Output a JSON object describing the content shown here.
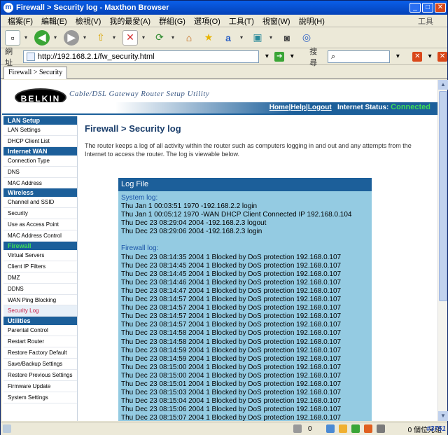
{
  "window": {
    "title": "Firewall > Security log - Maxthon Browser",
    "app_icon": "m"
  },
  "menu": {
    "items": [
      "檔案(F)",
      "編輯(E)",
      "檢視(V)",
      "我的最愛(A)",
      "群組(G)",
      "選項(O)",
      "工具(T)",
      "視窗(W)",
      "說明(H)"
    ],
    "right_label": "工具"
  },
  "address": {
    "label": "網址",
    "url": "http://192.168.2.1/fw_security.html",
    "search_label": "搜尋"
  },
  "tab": {
    "label": "Firewall > Security"
  },
  "banner": {
    "logo": "BELKIN",
    "tagline": "Cable/DSL Gateway Router Setup Utility",
    "home": "Home",
    "help": "Help",
    "logout": "Logout",
    "sep": "|",
    "internet_status_label": "Internet Status:",
    "internet_status_value": "Connected"
  },
  "sidebar": {
    "groups": [
      {
        "header": "LAN Setup",
        "items": [
          "LAN Settings",
          "DHCP Client List"
        ]
      },
      {
        "header": "Internet WAN",
        "items": [
          "Connection Type",
          "DNS",
          "MAC Address"
        ]
      },
      {
        "header": "Wireless",
        "items": [
          "Channel and SSID",
          "Security",
          "Use as Access Point",
          "MAC Address Control"
        ]
      },
      {
        "header": "Firewall",
        "items": [
          "Virtual Servers",
          "Client IP Filters",
          "DMZ",
          "DDNS",
          "WAN Ping Blocking",
          "Security Log"
        ]
      },
      {
        "header": "Utilities",
        "items": [
          "Parental Control",
          "Restart Router",
          "Restore Factory Default",
          "Save/Backup Settings",
          "Restore Previous Settings",
          "Firmware Update",
          "System Settings"
        ]
      }
    ]
  },
  "main": {
    "title": "Firewall > Security log",
    "intro": "The router keeps a log of all activity within the router such as computers logging in and out and any attempts from the Internet to access the router. The log is viewable below.",
    "logfile_title": "Log File",
    "system_log_label": "System log:",
    "system_log": [
      "Thu Jan 1 00:03:51 1970 -192.168.2.2 login",
      "Thu Jan 1 00:05:12 1970 -WAN DHCP Client Connected IP 192.168.0.104",
      "Thu Dec 23 08:29:04 2004 -192.168.2.3 logout",
      "Thu Dec 23 08:29:06 2004 -192.168.2.3 login"
    ],
    "firewall_log_label": "Firewall log:",
    "firewall_log": [
      "Thu Dec 23 08:14:35 2004 1 Blocked by DoS protection 192.168.0.107",
      "Thu Dec 23 08:14:45 2004 1 Blocked by DoS protection 192.168.0.107",
      "Thu Dec 23 08:14:45 2004 1 Blocked by DoS protection 192.168.0.107",
      "Thu Dec 23 08:14:46 2004 1 Blocked by DoS protection 192.168.0.107",
      "Thu Dec 23 08:14:47 2004 1 Blocked by DoS protection 192.168.0.107",
      "Thu Dec 23 08:14:57 2004 1 Blocked by DoS protection 192.168.0.107",
      "Thu Dec 23 08:14:57 2004 1 Blocked by DoS protection 192.168.0.107",
      "Thu Dec 23 08:14:57 2004 1 Blocked by DoS protection 192.168.0.107",
      "Thu Dec 23 08:14:57 2004 1 Blocked by DoS protection 192.168.0.107",
      "Thu Dec 23 08:14:58 2004 1 Blocked by DoS protection 192.168.0.107",
      "Thu Dec 23 08:14:58 2004 1 Blocked by DoS protection 192.168.0.107",
      "Thu Dec 23 08:14:59 2004 1 Blocked by DoS protection 192.168.0.107",
      "Thu Dec 23 08:14:59 2004 1 Blocked by DoS protection 192.168.0.107",
      "Thu Dec 23 08:15:00 2004 1 Blocked by DoS protection 192.168.0.107",
      "Thu Dec 23 08:15:00 2004 1 Blocked by DoS protection 192.168.0.107",
      "Thu Dec 23 08:15:01 2004 1 Blocked by DoS protection 192.168.0.107",
      "Thu Dec 23 08:15:03 2004 1 Blocked by DoS protection 192.168.0.107",
      "Thu Dec 23 08:15:04 2004 1 Blocked by DoS protection 192.168.0.107",
      "Thu Dec 23 08:15:06 2004 1 Blocked by DoS protection 192.168.0.107",
      "Thu Dec 23 08:15:07 2004 1 Blocked by DoS protection 192.168.0.107"
    ]
  },
  "status": {
    "count": "0",
    "bytes": "0 個位元組",
    "watermark": "#3751"
  },
  "colors": {
    "brand_blue": "#1c5f9a",
    "log_bg": "#94cbe2",
    "connected": "#3ddc57",
    "active_item": "#c4163f"
  }
}
